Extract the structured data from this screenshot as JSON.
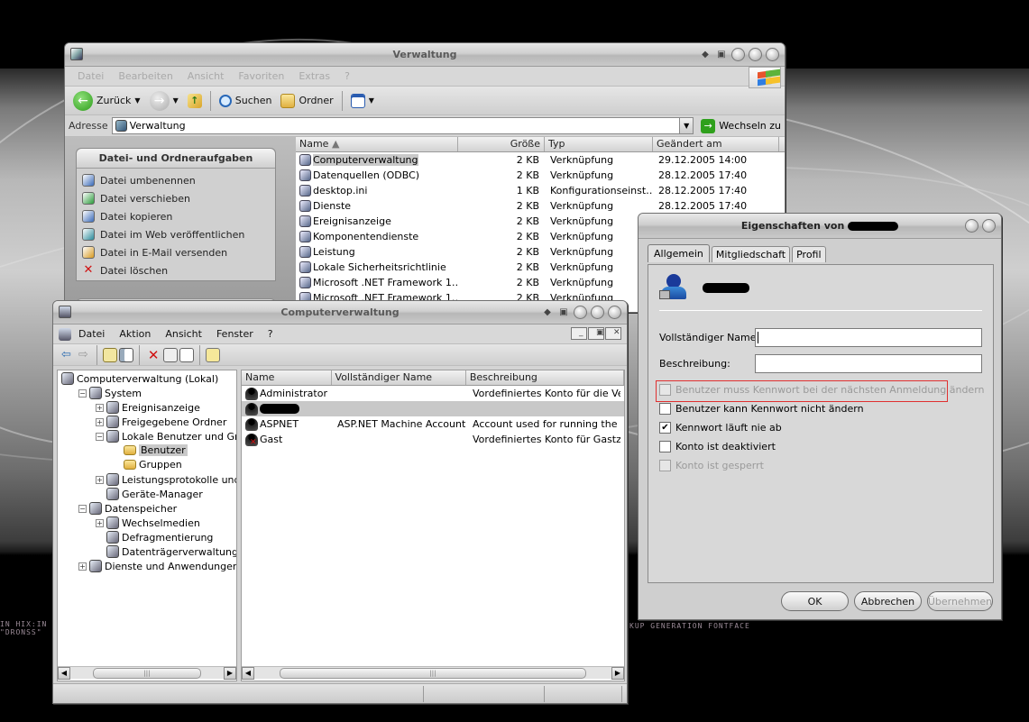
{
  "desktop": {
    "caption_left": "IN HIX:IN\n\"DRONSS\"",
    "caption_right": "KUP GENERATION FONTFACE"
  },
  "explorer": {
    "title": "Verwaltung",
    "menu": [
      "Datei",
      "Bearbeiten",
      "Ansicht",
      "Favoriten",
      "Extras",
      "?"
    ],
    "toolbar": {
      "back": "Zurück",
      "search": "Suchen",
      "folders": "Ordner"
    },
    "address_label": "Adresse",
    "address_value": "Verwaltung",
    "go_label": "Wechseln zu",
    "tasks_title": "Datei- und Ordneraufgaben",
    "tasks": [
      "Datei umbenennen",
      "Datei verschieben",
      "Datei kopieren",
      "Datei im Web veröffentlichen",
      "Datei in E-Mail versenden",
      "Datei löschen"
    ],
    "columns": [
      "Name",
      "Größe",
      "Typ",
      "Geändert am"
    ],
    "files": [
      {
        "name": "Computerverwaltung",
        "size": "2 KB",
        "type": "Verknüpfung",
        "date": "29.12.2005 14:00"
      },
      {
        "name": "Datenquellen (ODBC)",
        "size": "2 KB",
        "type": "Verknüpfung",
        "date": "28.12.2005 17:40"
      },
      {
        "name": "desktop.ini",
        "size": "1 KB",
        "type": "Konfigurationseinst…",
        "date": "28.12.2005 17:40"
      },
      {
        "name": "Dienste",
        "size": "2 KB",
        "type": "Verknüpfung",
        "date": "28.12.2005 17:40"
      },
      {
        "name": "Ereignisanzeige",
        "size": "2 KB",
        "type": "Verknüpfung",
        "date": ""
      },
      {
        "name": "Komponentendienste",
        "size": "2 KB",
        "type": "Verknüpfung",
        "date": ""
      },
      {
        "name": "Leistung",
        "size": "2 KB",
        "type": "Verknüpfung",
        "date": ""
      },
      {
        "name": "Lokale Sicherheitsrichtlinie",
        "size": "2 KB",
        "type": "Verknüpfung",
        "date": ""
      },
      {
        "name": "Microsoft .NET Framework 1….",
        "size": "2 KB",
        "type": "Verknüpfung",
        "date": ""
      },
      {
        "name": "Microsoft .NET Framework 1….",
        "size": "2 KB",
        "type": "Verknüpfung",
        "date": ""
      }
    ]
  },
  "mmc": {
    "title": "Computerverwaltung",
    "menu": [
      "Datei",
      "Aktion",
      "Ansicht",
      "Fenster",
      "?"
    ],
    "tree": [
      {
        "label": "Computerverwaltung (Lokal)",
        "level": 0,
        "exp": ""
      },
      {
        "label": "System",
        "level": 1,
        "exp": "−"
      },
      {
        "label": "Ereignisanzeige",
        "level": 2,
        "exp": "+"
      },
      {
        "label": "Freigegebene Ordner",
        "level": 2,
        "exp": "+"
      },
      {
        "label": "Lokale Benutzer und Gruppen",
        "level": 2,
        "exp": "−"
      },
      {
        "label": "Benutzer",
        "level": 3,
        "exp": ""
      },
      {
        "label": "Gruppen",
        "level": 3,
        "exp": ""
      },
      {
        "label": "Leistungsprotokolle und Warnungen",
        "level": 2,
        "exp": "+"
      },
      {
        "label": "Geräte-Manager",
        "level": 2,
        "exp": ""
      },
      {
        "label": "Datenspeicher",
        "level": 1,
        "exp": "−"
      },
      {
        "label": "Wechselmedien",
        "level": 2,
        "exp": "+"
      },
      {
        "label": "Defragmentierung",
        "level": 2,
        "exp": ""
      },
      {
        "label": "Datenträgerverwaltung",
        "level": 2,
        "exp": ""
      },
      {
        "label": "Dienste und Anwendungen",
        "level": 1,
        "exp": "+"
      }
    ],
    "columns": [
      "Name",
      "Vollständiger Name",
      "Beschreibung"
    ],
    "users": [
      {
        "name": "Administrator",
        "full": "",
        "desc": "Vordefiniertes Konto für die Verwal"
      },
      {
        "name": "",
        "full": "",
        "desc": ""
      },
      {
        "name": "ASPNET",
        "full": "ASP.NET Machine Account",
        "desc": "Account used for running the ASP.I"
      },
      {
        "name": "Gast",
        "full": "",
        "desc": "Vordefiniertes Konto für Gastzugrif"
      }
    ]
  },
  "props": {
    "title": "Eigenschaften von",
    "tabs": [
      "Allgemein",
      "Mitgliedschaft",
      "Profil"
    ],
    "fullname_label": "Vollständiger Name:",
    "desc_label": "Beschreibung:",
    "checks": [
      {
        "label": "Benutzer muss Kennwort bei der nächsten Anmeldung ändern",
        "checked": false,
        "disabled": true
      },
      {
        "label": "Benutzer kann Kennwort nicht ändern",
        "checked": false,
        "disabled": false
      },
      {
        "label": "Kennwort läuft nie ab",
        "checked": true,
        "disabled": false
      },
      {
        "label": "Konto ist deaktiviert",
        "checked": false,
        "disabled": false
      },
      {
        "label": "Konto ist gesperrt",
        "checked": false,
        "disabled": true
      }
    ],
    "ok": "OK",
    "cancel": "Abbrechen",
    "apply": "Übernehmen"
  },
  "colors": {
    "highlight": "#c9c9c9",
    "red_outline": "#e03030",
    "delete_red": "#d01010"
  }
}
